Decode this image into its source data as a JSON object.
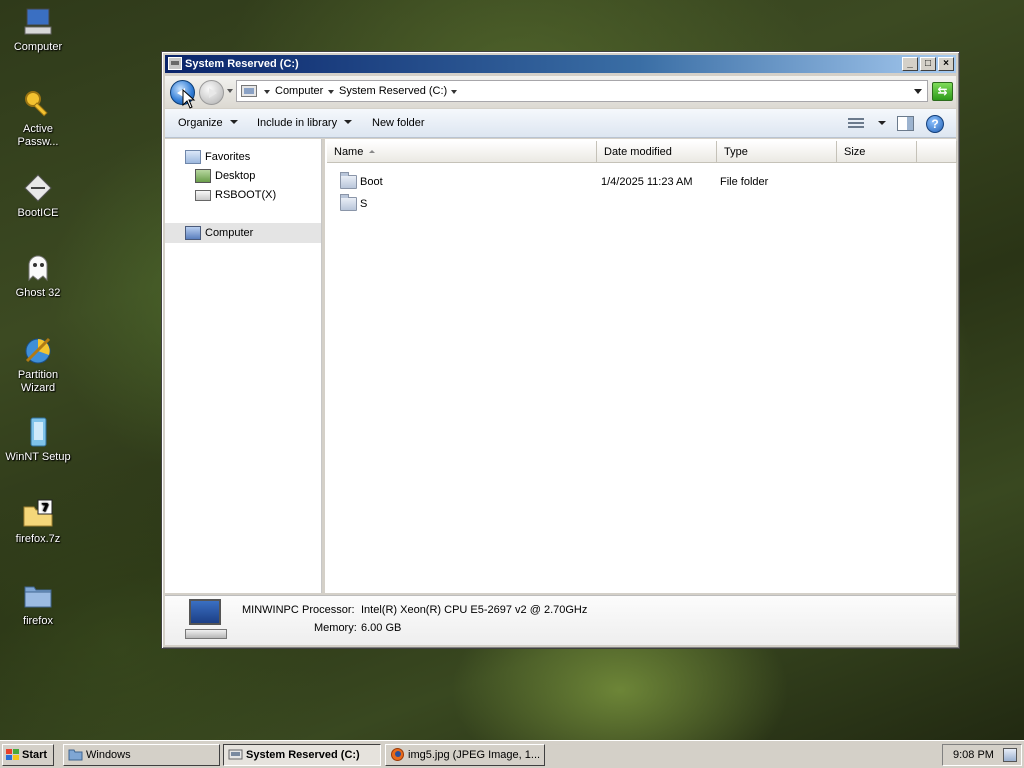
{
  "desktop": {
    "icons": [
      {
        "label": "Computer",
        "icon": "computer-icon"
      },
      {
        "label": "Active Passw...",
        "icon": "key-icon"
      },
      {
        "label": "BootICE",
        "icon": "bootice-icon"
      },
      {
        "label": "Ghost 32",
        "icon": "ghost-icon"
      },
      {
        "label": "Partition Wizard",
        "icon": "partition-wizard-icon"
      },
      {
        "label": "WinNT Setup",
        "icon": "winnt-setup-icon"
      },
      {
        "label": "firefox.7z",
        "icon": "archive-icon"
      },
      {
        "label": "firefox",
        "icon": "folder-icon"
      }
    ]
  },
  "window": {
    "title": "System Reserved (C:)",
    "buttons": {
      "minimize": "_",
      "maximize": "□",
      "close": "×"
    },
    "address": {
      "crumbs": [
        "Computer",
        "System Reserved (C:)"
      ]
    },
    "toolbar": {
      "organize": "Organize",
      "include_in_library": "Include in library",
      "new_folder": "New folder"
    },
    "nav": {
      "favorites": "Favorites",
      "desktop": "Desktop",
      "rsboot": "RSBOOT(X)",
      "computer": "Computer"
    },
    "columns": [
      "Name",
      "Date modified",
      "Type",
      "Size"
    ],
    "files": [
      {
        "name": "Boot",
        "date": "1/4/2025 11:23 AM",
        "type": "File folder",
        "size": ""
      },
      {
        "name": "S",
        "date": "",
        "type": "",
        "size": ""
      }
    ],
    "details": {
      "computer_name": "MINWINPC",
      "processor_label": "Processor:",
      "processor": "Intel(R) Xeon(R) CPU E5-2697 v2 @ 2.70GHz",
      "memory_label": "Memory:",
      "memory": "6.00 GB"
    }
  },
  "taskbar": {
    "start": "Start",
    "tasks": [
      "Windows",
      "System Reserved (C:)",
      "img5.jpg (JPEG Image, 1..."
    ],
    "clock": "9:08 PM"
  },
  "colors": {
    "accent": "#0a246a",
    "taskbar": "#d4d0c8"
  }
}
